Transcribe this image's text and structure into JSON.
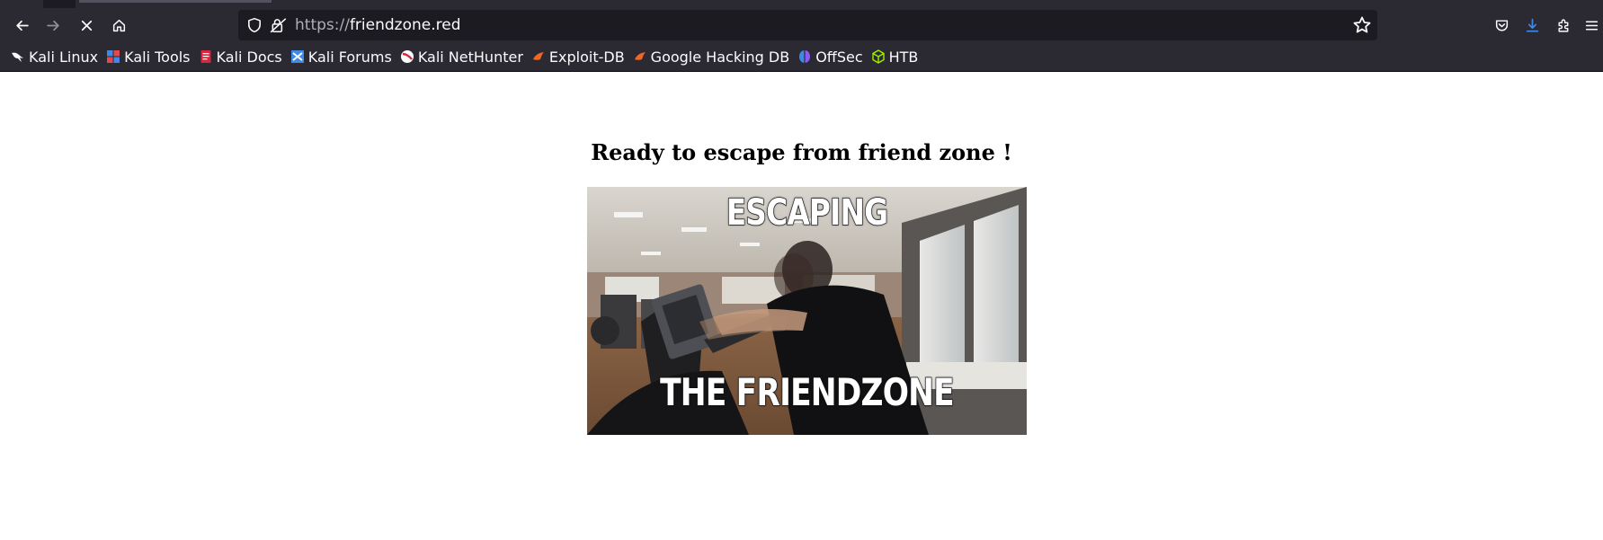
{
  "browser": {
    "url_scheme": "https://",
    "url_host": "friendzone.red",
    "bookmarks": [
      {
        "label": "Kali Linux",
        "icon": "kali-dragon-icon"
      },
      {
        "label": "Kali Tools",
        "icon": "kali-tools-icon"
      },
      {
        "label": "Kali Docs",
        "icon": "kali-docs-icon"
      },
      {
        "label": "Kali Forums",
        "icon": "kali-forums-icon"
      },
      {
        "label": "Kali NetHunter",
        "icon": "kali-nethunter-icon"
      },
      {
        "label": "Exploit-DB",
        "icon": "exploit-db-icon"
      },
      {
        "label": "Google Hacking DB",
        "icon": "ghdb-icon"
      },
      {
        "label": "OffSec",
        "icon": "offsec-icon"
      },
      {
        "label": "HTB",
        "icon": "htb-cube-icon"
      }
    ],
    "colors": {
      "chrome": "#2b2a33",
      "urlbar": "#1c1b22",
      "text": "#fbfbfe",
      "download_accent": "#3d8ae8"
    }
  },
  "page": {
    "heading": "Ready to escape from friend zone !",
    "meme": {
      "top_text": "ESCAPING",
      "bottom_text": "THE FRIENDZONE"
    }
  }
}
